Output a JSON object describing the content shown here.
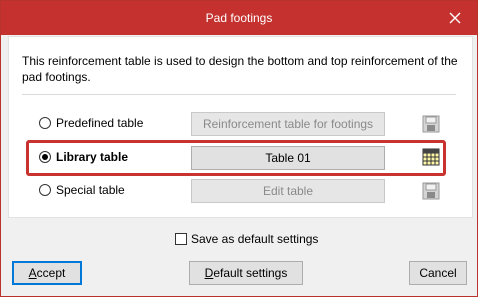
{
  "dialog": {
    "title": "Pad footings",
    "description": "This reinforcement table is used to design the bottom and top reinforcement of the pad footings."
  },
  "options": [
    {
      "label": "Predefined table",
      "checked": false,
      "button": "Reinforcement table for footings",
      "button_enabled": false,
      "icon": "disk-icon"
    },
    {
      "label": "Library table",
      "checked": true,
      "button": "Table 01",
      "button_enabled": true,
      "icon": "table-grid-icon"
    },
    {
      "label": "Special table",
      "checked": false,
      "button": "Edit table",
      "button_enabled": false,
      "icon": "disk-icon"
    }
  ],
  "save_default": {
    "label": "Save as default settings",
    "checked": false
  },
  "footer": {
    "accept_first": "A",
    "accept_rest": "ccept",
    "default_first": "D",
    "default_rest": "efault settings",
    "cancel": "Cancel"
  },
  "colors": {
    "titlebar": "#c4312e",
    "highlight": "#c8322f",
    "focus": "#0078d7"
  }
}
